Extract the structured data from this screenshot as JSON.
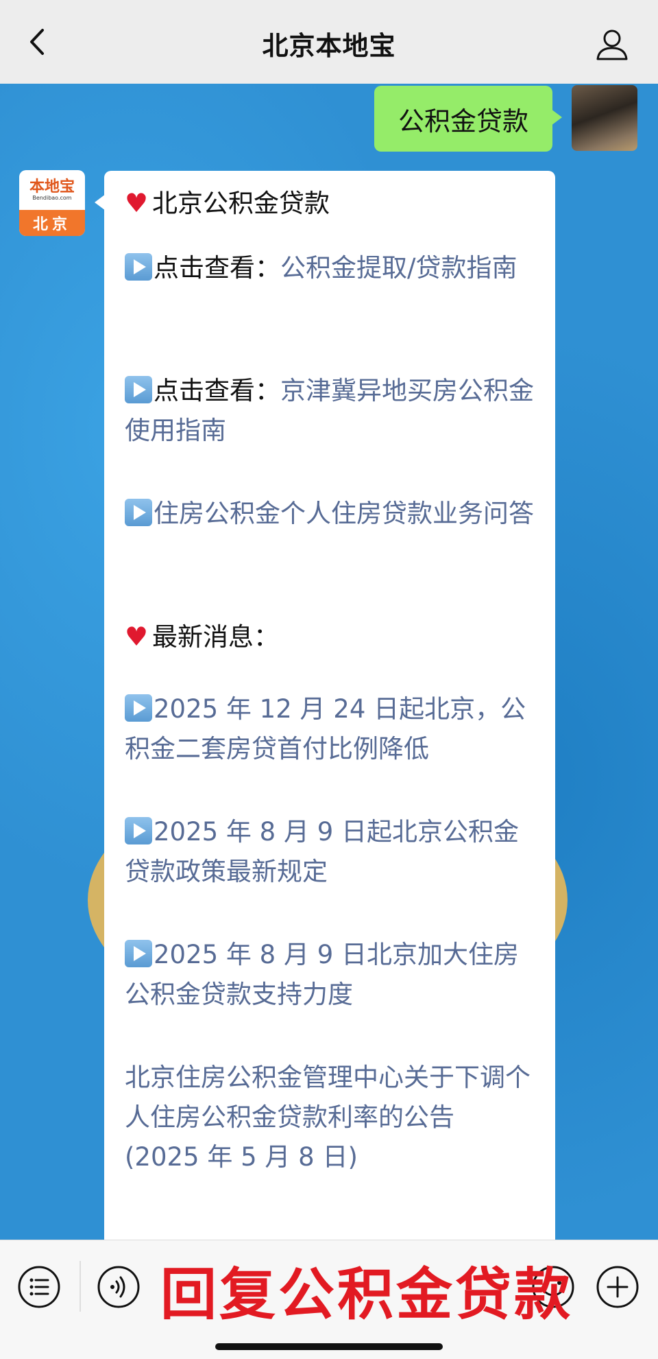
{
  "header": {
    "title": "北京本地宝"
  },
  "user_message": "公积金贷款",
  "bot": {
    "avatar_brand": "本地宝",
    "avatar_url": "Bendibao.com",
    "avatar_city": "北京",
    "sections": {
      "heading1": "北京公积金贷款",
      "item1_prefix": "点击查看：",
      "item1_link": "公积金提取/贷款指南",
      "item2_prefix": "点击查看：",
      "item2_link": "京津冀异地买房公积金使用指南",
      "item3": "住房公积金个人住房贷款业务问答",
      "heading2": "最新消息：",
      "news1": "2025 年 12 月 24 日起北京，公积金二套房贷首付比例降低",
      "news2": "2025 年 8 月 9 日起北京公积金贷款政策最新规定",
      "news3": "2025 年 8 月 9 日北京加大住房公积金贷款支持力度",
      "news4": "北京住房公积金管理中心关于下调个人住房公积金贷款利率的公告 (2025 年 5 月 8 日)"
    }
  },
  "overlay": {
    "text": "回复公积金贷款"
  },
  "colors": {
    "link": "#576b95",
    "bubble_green": "#95ec69",
    "overlay_red": "#e21a22"
  },
  "icons": [
    "back-icon",
    "user-icon",
    "menu-list-icon",
    "voice-icon",
    "emoji-icon",
    "plus-icon",
    "heart-icon",
    "play-icon"
  ]
}
